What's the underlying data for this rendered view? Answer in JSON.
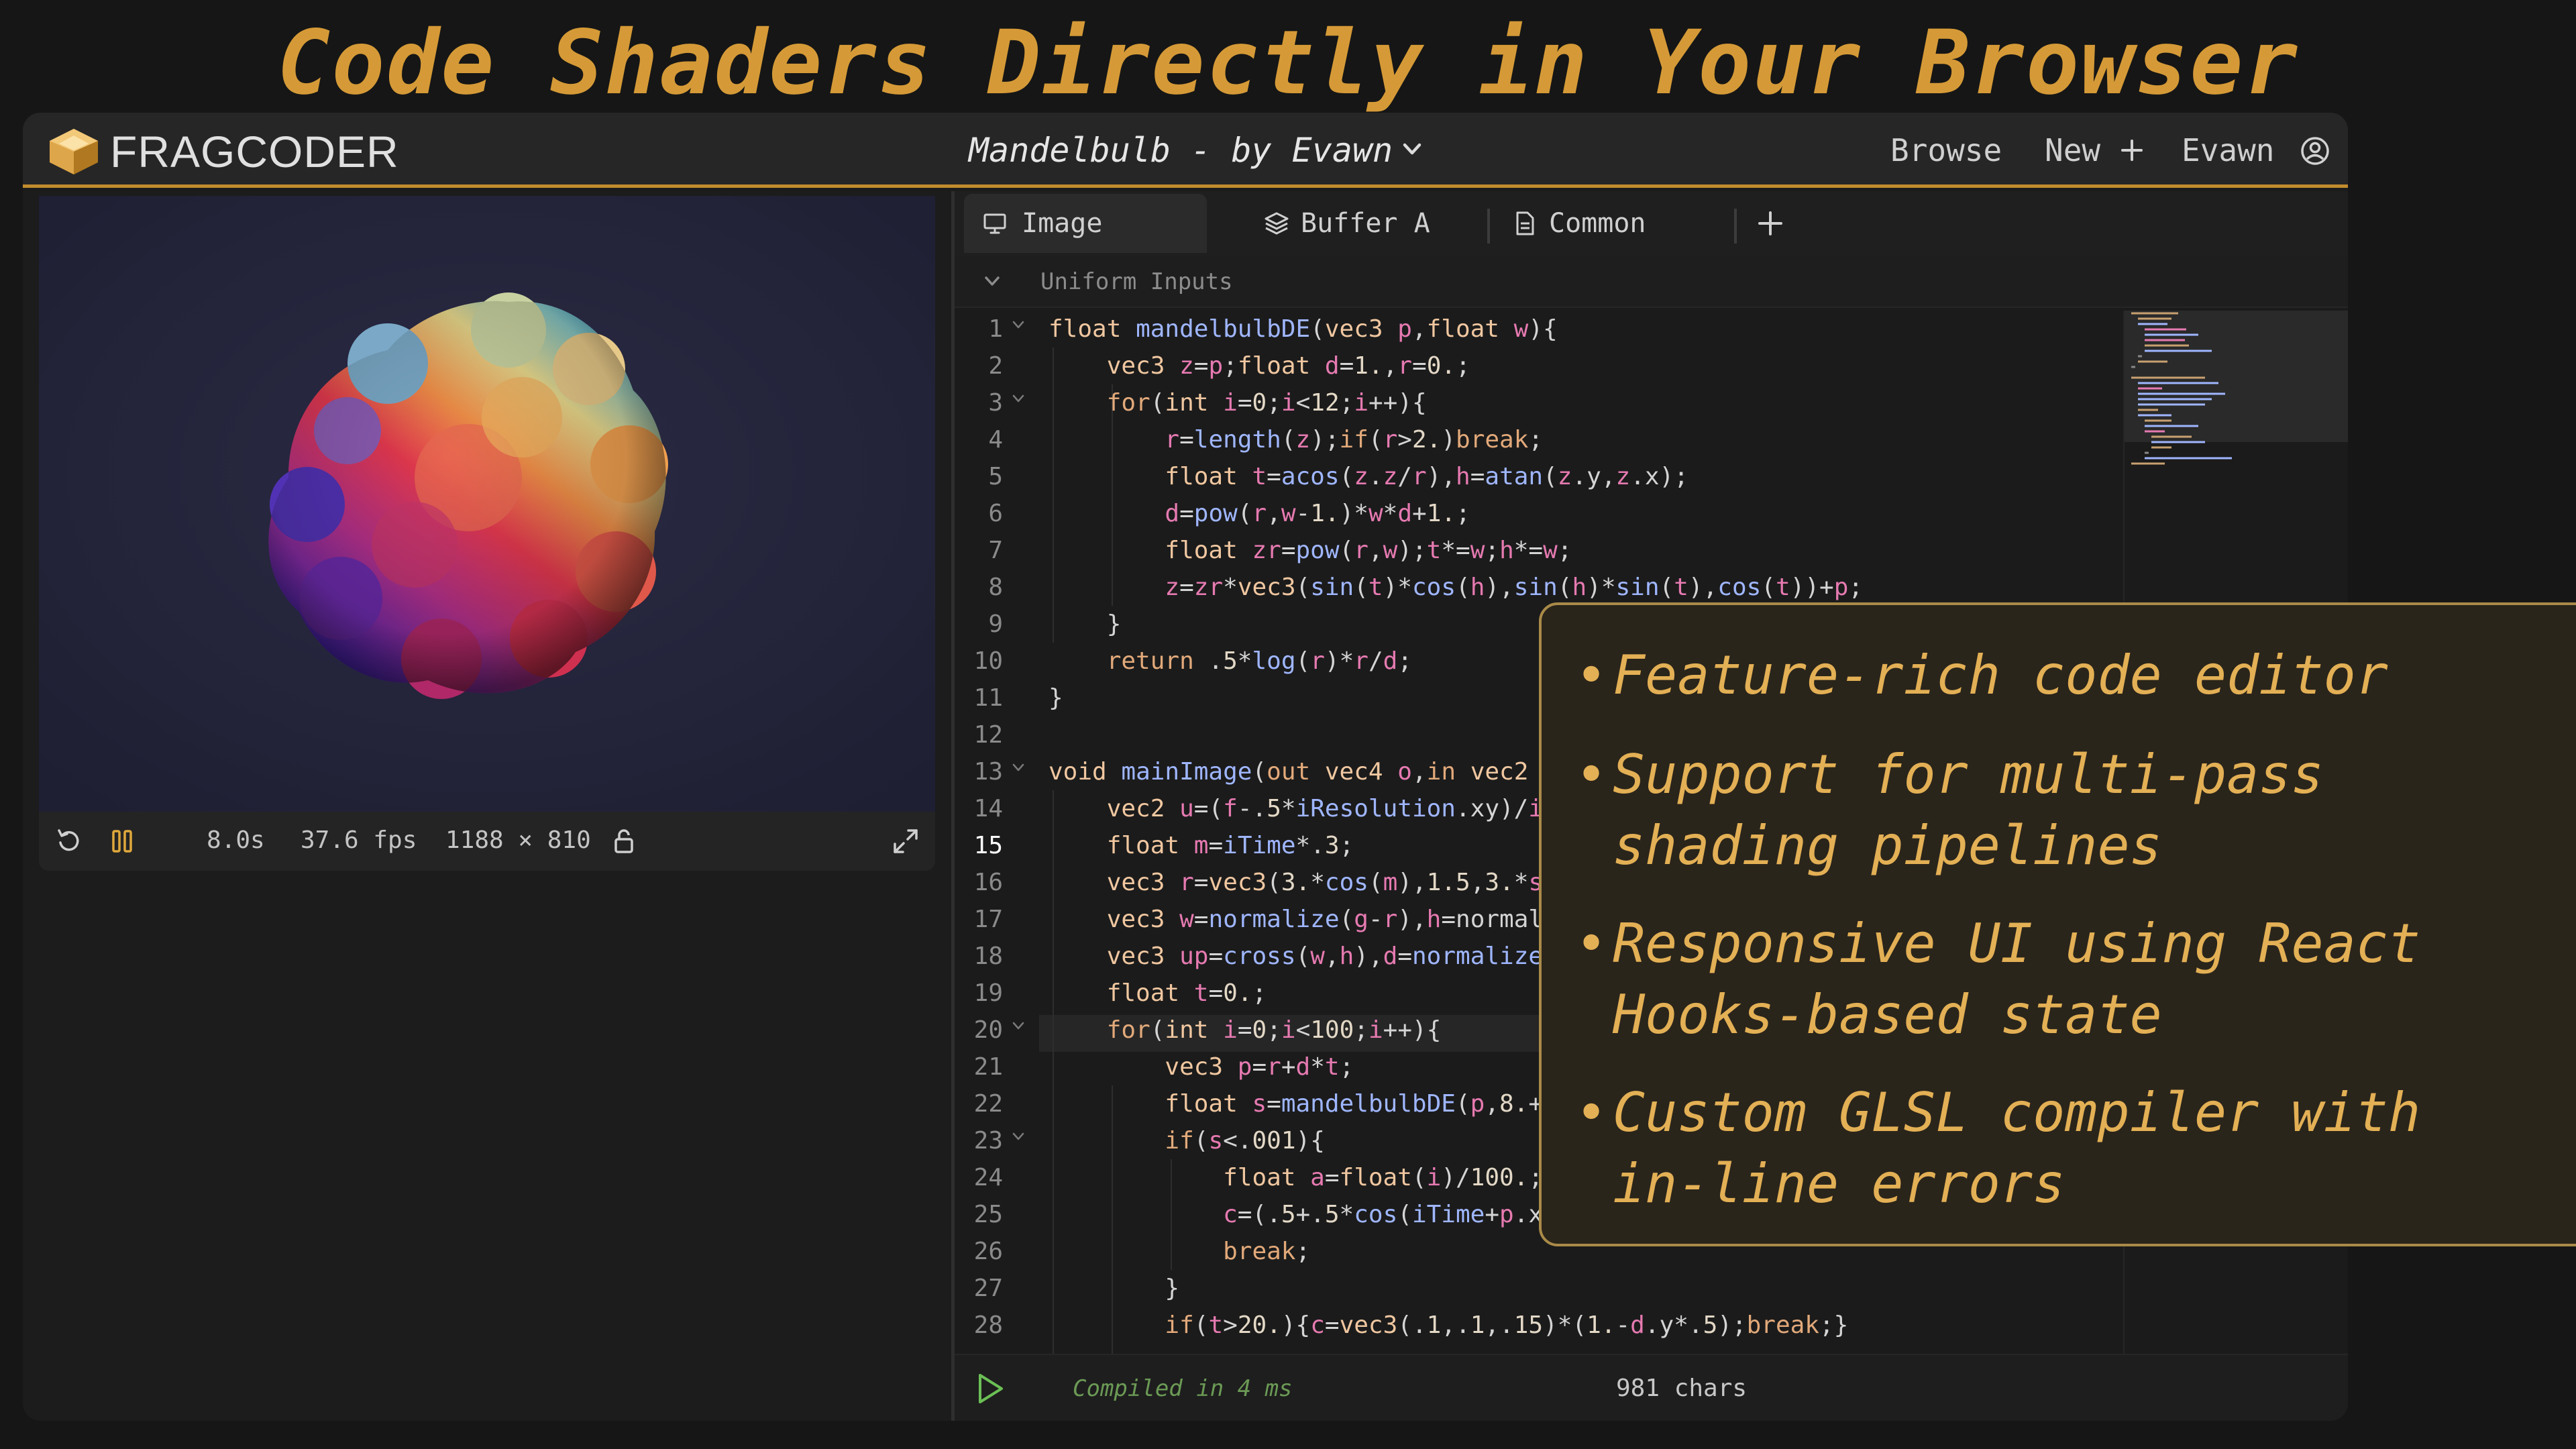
{
  "headline": "Code Shaders Directly in Your Browser",
  "app": {
    "brand": "FRAGCODER",
    "title": "Mandelbulb - by Evawn",
    "nav": {
      "browse": "Browse",
      "new": "New",
      "user": "Evawn"
    }
  },
  "preview": {
    "time": "8.0s",
    "fps": "37.6 fps",
    "resolution": "1188 × 810"
  },
  "editor": {
    "tabs": [
      {
        "label": "Image",
        "icon": "monitor-icon",
        "active": true
      },
      {
        "label": "Buffer A",
        "icon": "layers-icon",
        "active": false
      },
      {
        "label": "Common",
        "icon": "file-icon",
        "active": false
      }
    ],
    "uniforms_label": "Uniform Inputs",
    "current_line": 15,
    "line_numbers": [
      "1",
      "2",
      "3",
      "4",
      "5",
      "6",
      "7",
      "8",
      "9",
      "10",
      "11",
      "12",
      "13",
      "14",
      "15",
      "16",
      "17",
      "18",
      "19",
      "20",
      "21",
      "22",
      "23",
      "24",
      "25",
      "26",
      "27",
      "28"
    ],
    "code_lines": [
      "float mandelbulbDE(vec3 p,float w){",
      "    vec3 z=p;float d=1.,r=0.;",
      "    for(int i=0;i<12;i++){",
      "        r=length(z);if(r>2.)break;",
      "        float t=acos(z.z/r),h=atan(z.y,z.x);",
      "        d=pow(r,w-1.)*w*d+1.;",
      "        float zr=pow(r,w);t*=w;h*=w;",
      "        z=zr*vec3(sin(t)*cos(h),sin(h)*sin(t),cos(t))+p;",
      "    }",
      "    return .5*log(r)*r/d;",
      "}",
      "",
      "void mainImage(out vec4 o,in vec2",
      "    vec2 u=(f-.5*iResolution.xy)/i",
      "    float m=iTime*.3;",
      "    vec3 r=vec3(3.*cos(m),1.5,3.*s",
      "    vec3 w=normalize(g-r),h=normal",
      "    vec3 up=cross(w,h),d=normalize",
      "    float t=0.;",
      "    for(int i=0;i<100;i++){",
      "        vec3 p=r+d*t;",
      "        float s=mandelbulbDE(p,8.+",
      "        if(s<.001){",
      "            float a=float(i)/100.;",
      "            c=(.5+.5*cos(iTime+p.x",
      "            break;",
      "        }",
      "        if(t>20.){c=vec3(.1,.1,.15)*(1.-d.y*.5);break;}"
    ],
    "status": {
      "compiled": "Compiled in 4 ms",
      "chars": "981 chars"
    }
  },
  "callout": {
    "bullets": [
      "Feature-rich code editor",
      "Support for multi-pass shading pipelines",
      "Responsive UI using React Hooks-based state",
      "Custom GLSL compiler with in-line errors"
    ]
  }
}
